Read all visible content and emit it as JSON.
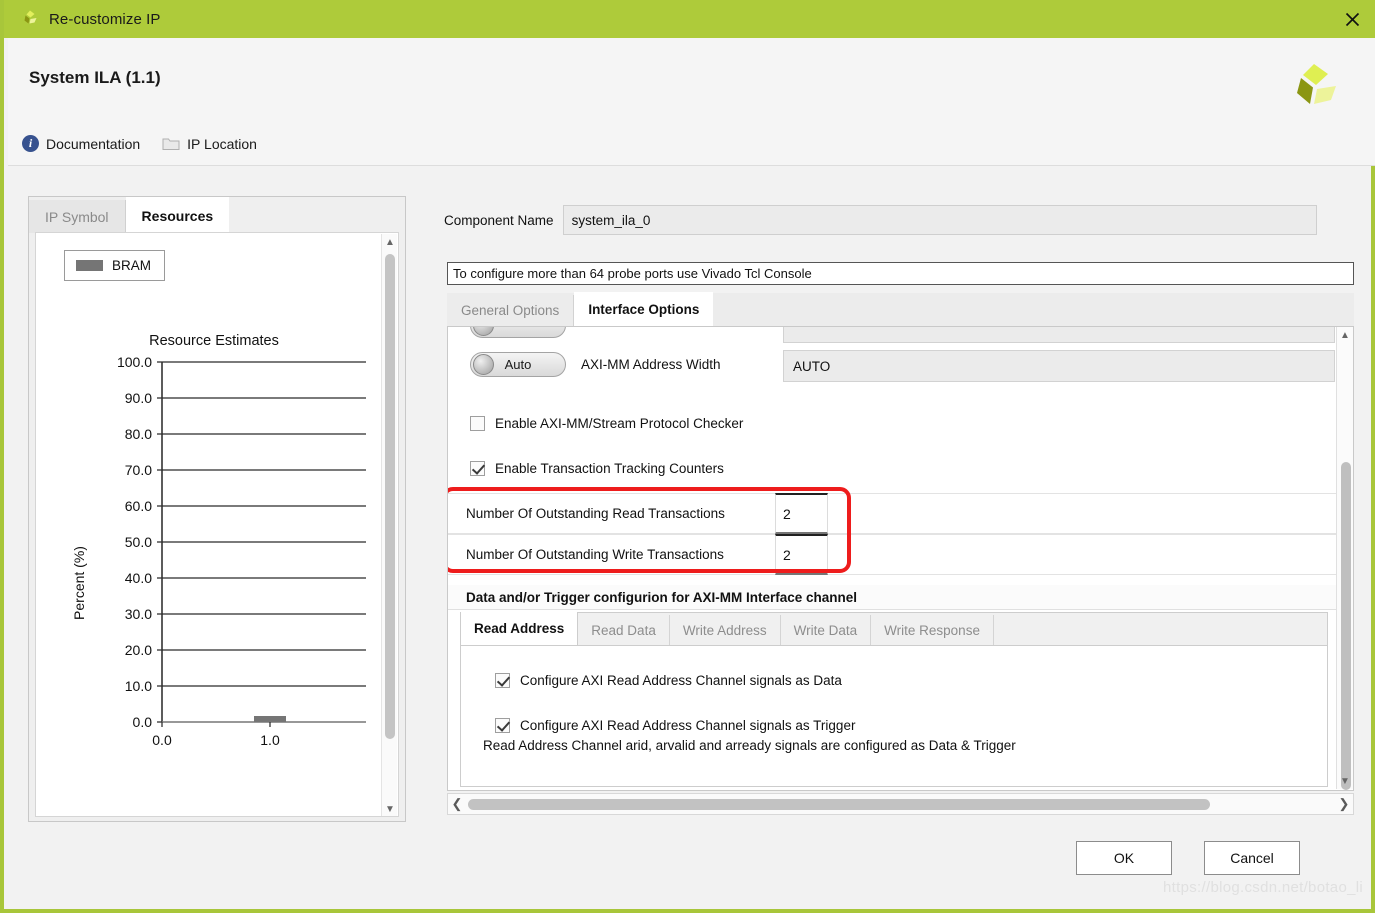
{
  "window": {
    "title": "Re-customize IP",
    "close_icon": "close-icon",
    "app_icon": "xilinx-logo-icon",
    "titlebar_color": "#aecb3a"
  },
  "header": {
    "ip_title": "System ILA (1.1)",
    "logo_icon": "xilinx-logo-icon",
    "links": [
      {
        "label": "Documentation",
        "icon": "info-icon"
      },
      {
        "label": "IP Location",
        "icon": "folder-icon"
      }
    ]
  },
  "left_panel": {
    "tabs": [
      {
        "label": "IP Symbol",
        "active": false
      },
      {
        "label": "Resources",
        "active": true
      }
    ],
    "scroll_up_icon": "chevron-up-icon",
    "scroll_down_icon": "chevron-down-icon"
  },
  "chart_data": {
    "type": "bar",
    "title": "Resource Estimates",
    "xlabel": "",
    "ylabel": "Percent (%)",
    "categories": [
      "0.0",
      "1.0"
    ],
    "x": [
      0.0,
      1.0
    ],
    "values": [
      0,
      1.0
    ],
    "series": [
      {
        "name": "BRAM",
        "values": [
          0,
          1.0
        ],
        "color": "#757575"
      }
    ],
    "legend": [
      "BRAM"
    ],
    "legend_position": "top-left",
    "ylim": [
      0,
      100
    ],
    "yticks": [
      "0.0",
      "10.0",
      "20.0",
      "30.0",
      "40.0",
      "50.0",
      "60.0",
      "70.0",
      "80.0",
      "90.0",
      "100.0"
    ],
    "ytick_values": [
      0,
      10,
      20,
      30,
      40,
      50,
      60,
      70,
      80,
      90,
      100
    ],
    "xticks": [
      "0.0",
      "1.0"
    ],
    "xtick_values": [
      0.0,
      1.0
    ],
    "grid": true
  },
  "right_panel": {
    "component_name_label": "Component Name",
    "component_name_value": "system_ila_0",
    "tcl_note": "To configure more than 64 probe ports use Vivado Tcl Console",
    "tabs": [
      {
        "label": "General Options",
        "active": false
      },
      {
        "label": "Interface Options",
        "active": true
      }
    ],
    "address_width": {
      "toggle_label": "Auto",
      "field_label": "AXI-MM Address Width",
      "value": "AUTO"
    },
    "checkboxes": [
      {
        "label": "Enable AXI-MM/Stream Protocol Checker",
        "checked": false
      },
      {
        "label": "Enable Transaction Tracking Counters",
        "checked": true
      }
    ],
    "transactions": [
      {
        "label": "Number Of Outstanding Read Transactions",
        "value": "2"
      },
      {
        "label": "Number Of Outstanding Write Transactions",
        "value": "2"
      }
    ],
    "highlight_color": "#ee1c1c",
    "data_trigger": {
      "header": "Data and/or Trigger configurion for AXI-MM Interface channel",
      "tabs": [
        {
          "label": "Read Address",
          "active": true
        },
        {
          "label": "Read Data",
          "active": false
        },
        {
          "label": "Write Address",
          "active": false
        },
        {
          "label": "Write Data",
          "active": false
        },
        {
          "label": "Write Response",
          "active": false
        }
      ],
      "checkboxes": [
        {
          "label": "Configure AXI Read Address Channel signals as Data",
          "checked": true
        },
        {
          "label": "Configure AXI Read Address Channel signals as Trigger",
          "checked": true
        }
      ],
      "note": "Read Address Channel arid, arvalid and arready signals are configured as Data & Trigger"
    },
    "scroll_up_icon": "chevron-up-icon",
    "scroll_down_icon": "chevron-down-icon",
    "scroll_left_icon": "chevron-left-icon",
    "scroll_right_icon": "chevron-right-icon"
  },
  "footer": {
    "ok_label": "OK",
    "cancel_label": "Cancel",
    "watermark": "https://blog.csdn.net/botao_li"
  }
}
